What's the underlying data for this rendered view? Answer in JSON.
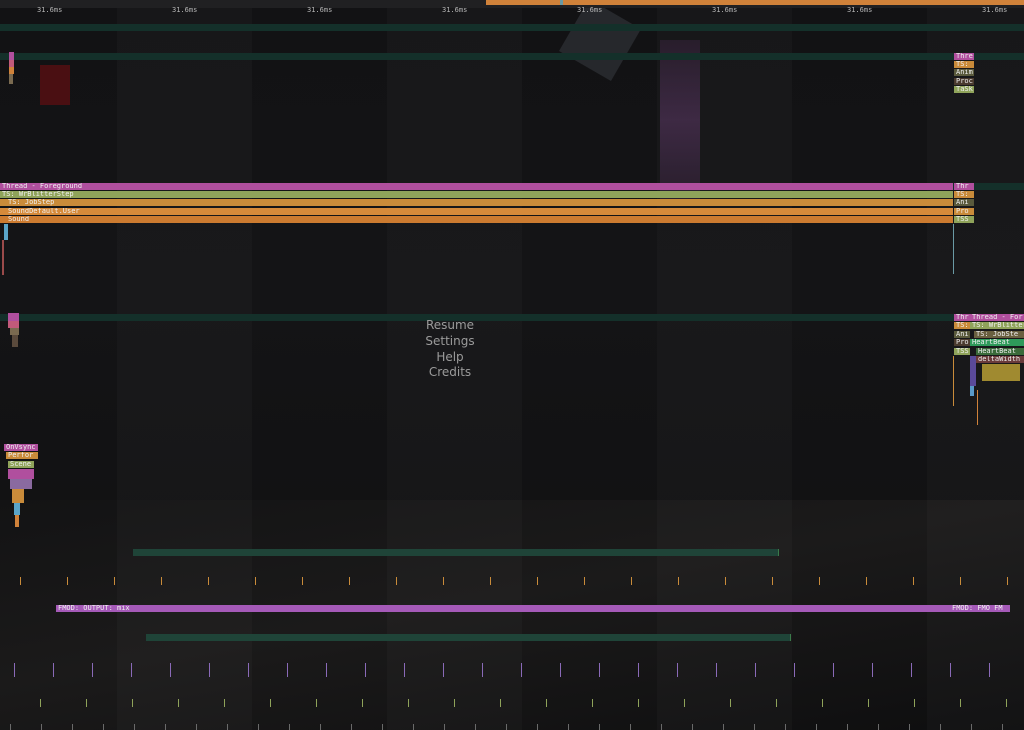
{
  "timeline": {
    "tick_labels": [
      "31.6ms",
      "31.6ms",
      "31.6ms",
      "31.6ms",
      "31.6ms",
      "31.6ms",
      "31.6ms",
      "31.6ms"
    ]
  },
  "main_thread": {
    "bars": [
      {
        "label": "Thread - Foreground",
        "color": "#b04f9e"
      },
      {
        "label": "TS: WrBlitterStep",
        "color": "#8fa35a"
      },
      {
        "label": "TS: JobStep",
        "color": "#c98b3a"
      },
      {
        "label": "SoundDefault.User",
        "color": "#d68a3a"
      },
      {
        "label": "Sound",
        "color": "#cc7b30"
      }
    ],
    "right_labels": [
      "Thr",
      "TS:",
      "Ani",
      "Pro",
      "TSS"
    ]
  },
  "top_right_labels": [
    "Thre",
    "TS: ",
    "Anim",
    "Proc",
    "TaSk"
  ],
  "mid_right_labels": {
    "col1": [
      "Thr",
      "TS:",
      "Ani",
      "Pro",
      "TSS"
    ],
    "col2": [
      "Thread - For",
      "TS: WrBlitters",
      "TS: JobSte",
      "HeartBeat",
      "HeartBeat",
      "deltaWidth"
    ]
  },
  "left_small_stack": [
    "OnVsync",
    "Perfor",
    "Scene"
  ],
  "pause_menu": {
    "items": [
      "Resume",
      "Settings",
      "Help",
      "Credits"
    ]
  },
  "fmod": {
    "bar_label": "FMOD: OUTPUT: mix",
    "right_label": "FMOD: FMO FM"
  },
  "colors": {
    "orange": "#d0823a",
    "purple": "#a55ab8",
    "green_band": "#1d3d33",
    "pink": "#b04f9e",
    "olive": "#8fa35a"
  }
}
